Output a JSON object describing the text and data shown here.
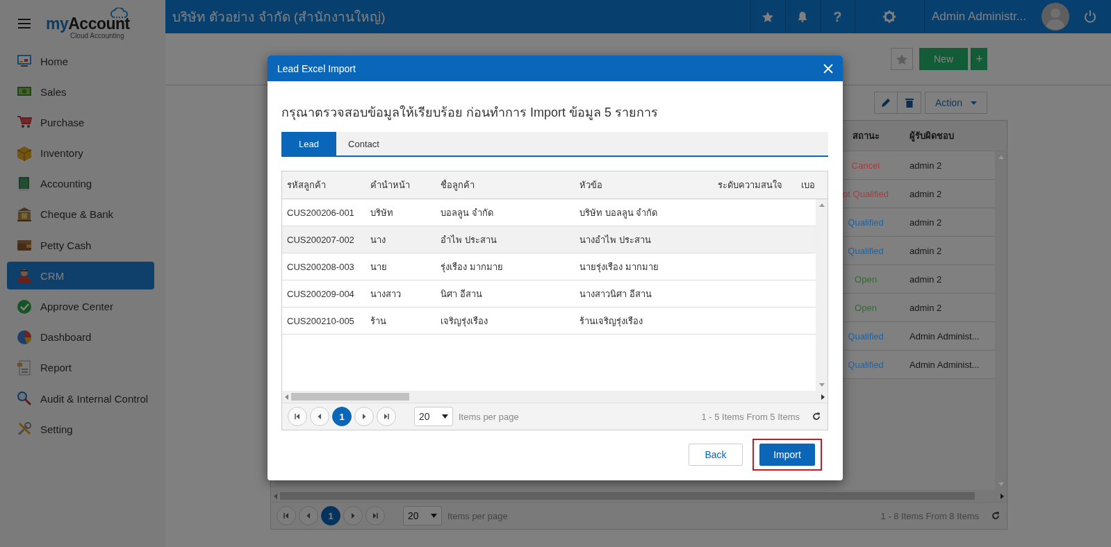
{
  "sidebar": {
    "brand_my": "my",
    "brand_account": "Account",
    "tagline": "Cloud Accounting",
    "items": [
      {
        "label": "Home",
        "selected": false
      },
      {
        "label": "Sales",
        "selected": false
      },
      {
        "label": "Purchase",
        "selected": false
      },
      {
        "label": "Inventory",
        "selected": false
      },
      {
        "label": "Accounting",
        "selected": false
      },
      {
        "label": "Cheque & Bank",
        "selected": false
      },
      {
        "label": "Petty Cash",
        "selected": false
      },
      {
        "label": "CRM",
        "selected": true
      },
      {
        "label": "Approve Center",
        "selected": false
      },
      {
        "label": "Dashboard",
        "selected": false
      },
      {
        "label": "Report",
        "selected": false
      },
      {
        "label": "Audit & Internal Control",
        "selected": false
      },
      {
        "label": "Setting",
        "selected": false
      }
    ]
  },
  "topbar": {
    "company": "บริษัท ตัวอย่าง จำกัด (สำนักงานใหญ่)",
    "help": "?",
    "user": "Admin Administr..."
  },
  "toolbar": {
    "new_button": "New",
    "plus_button": "+",
    "action_button": "Action"
  },
  "background_table": {
    "columns": [
      "สถานะ",
      "ผู้รับผิดชอบ"
    ],
    "rows": [
      {
        "status": "Cancel",
        "color": "#a83c3c",
        "owner": "admin 2"
      },
      {
        "status": "ot Qualified",
        "color": "#a83c3c",
        "owner": "admin 2"
      },
      {
        "status": "Qualified",
        "color": "#1d64a4",
        "owner": "admin 2"
      },
      {
        "status": "Qualified",
        "color": "#1d64a4",
        "owner": "admin 2"
      },
      {
        "status": "Open",
        "color": "#2f6b2f",
        "owner": "admin 2"
      },
      {
        "status": "Open",
        "color": "#2f6b2f",
        "owner": "admin 2"
      },
      {
        "status": "Qualified",
        "color": "#1d64a4",
        "owner": "Admin Administ..."
      },
      {
        "status": "Qualified",
        "color": "#1d64a4",
        "owner": "Admin Administ..."
      }
    ],
    "pager": {
      "pages": [
        {
          "label": "1",
          "selected": true
        }
      ],
      "page_size": "20",
      "per_page_label": "Items per page",
      "summary": "1 - 8 Items From 8 Items"
    }
  },
  "modal": {
    "title": "Lead Excel Import",
    "message": "กรุณาตรวจสอบข้อมูลให้เรียบร้อย ก่อนทำการ Import ข้อมูล 5 รายการ",
    "tabs": [
      {
        "label": "Lead",
        "selected": true
      },
      {
        "label": "Contact",
        "selected": false
      }
    ],
    "table": {
      "columns": [
        "รหัสลูกค้า",
        "คำนำหน้า",
        "ชื่อลูกค้า",
        "หัวข้อ",
        "ระดับความสนใจ",
        "เบอ"
      ],
      "rows": [
        {
          "cells": [
            "CUS200206-001",
            "บริษัท",
            "บอลลูน จำกัด",
            "บริษัท บอลลูน จำกัด"
          ],
          "selected": false
        },
        {
          "cells": [
            "CUS200207-002",
            "นาง",
            "อำไพ ประสาน",
            "นางอำไพ ประสาน"
          ],
          "selected": true
        },
        {
          "cells": [
            "CUS200208-003",
            "นาย",
            "รุ่งเรือง มากมาย",
            "นายรุ่งเรือง มากมาย"
          ],
          "selected": false
        },
        {
          "cells": [
            "CUS200209-004",
            "นางสาว",
            "นิศา อีสาน",
            "นางสาวนิศา อีสาน"
          ],
          "selected": false
        },
        {
          "cells": [
            "CUS200210-005",
            "ร้าน",
            "เจริญรุ่งเรือง",
            "ร้านเจริญรุ่งเรือง"
          ],
          "selected": false
        }
      ]
    },
    "pager": {
      "pages": [
        {
          "label": "1",
          "selected": true
        }
      ],
      "page_size": "20",
      "per_page_label": "Items per page",
      "summary": "1 - 5 Items From 5 Items"
    },
    "buttons": [
      {
        "label": "Back",
        "kind": "secondary",
        "highlighted": false
      },
      {
        "label": "Import",
        "kind": "primary",
        "highlighted": true
      }
    ]
  }
}
